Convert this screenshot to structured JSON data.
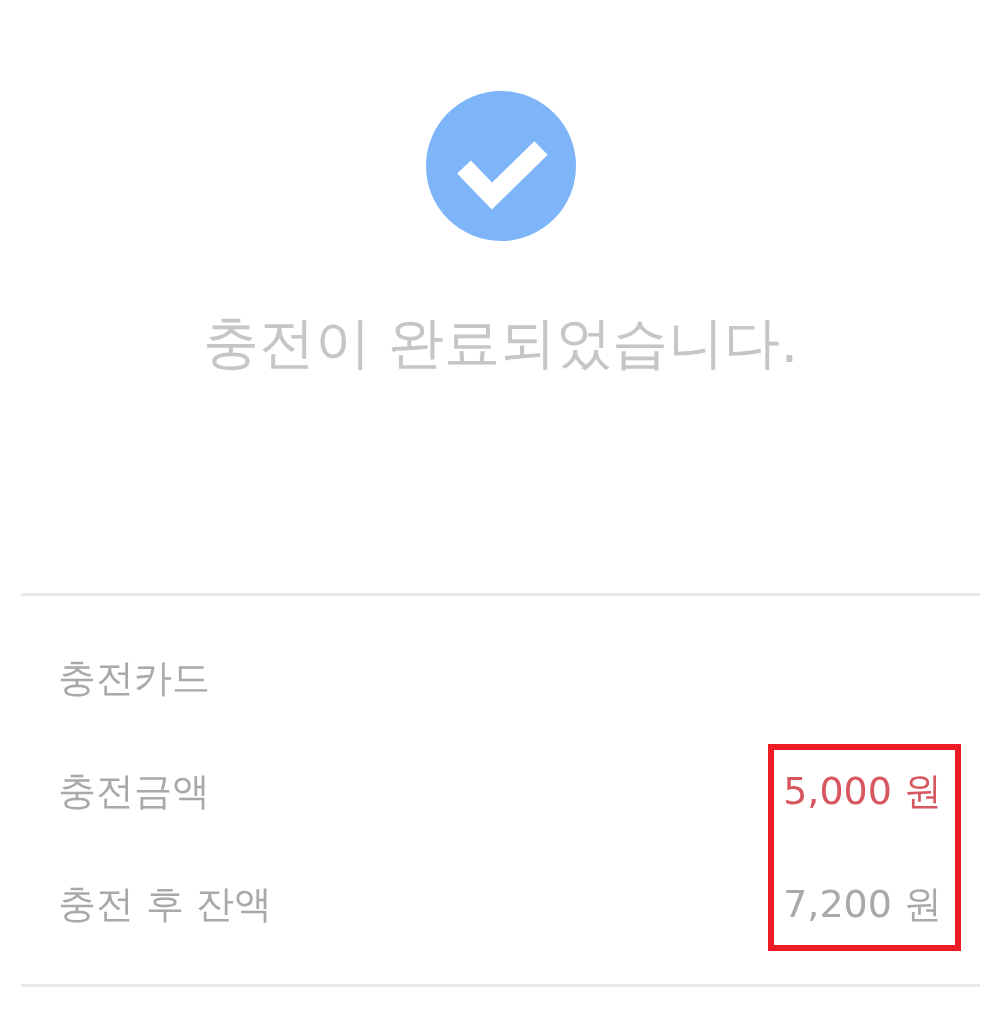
{
  "title": "충전이 완료되었습니다.",
  "details": [
    {
      "label": "충전카드"
    },
    {
      "label": "충전금액",
      "value": "5,000 원",
      "emphasized": true,
      "framed": true
    },
    {
      "label": "충전 후 잔액",
      "value": "7,200 원",
      "emphasized": false,
      "framed": true
    }
  ]
}
